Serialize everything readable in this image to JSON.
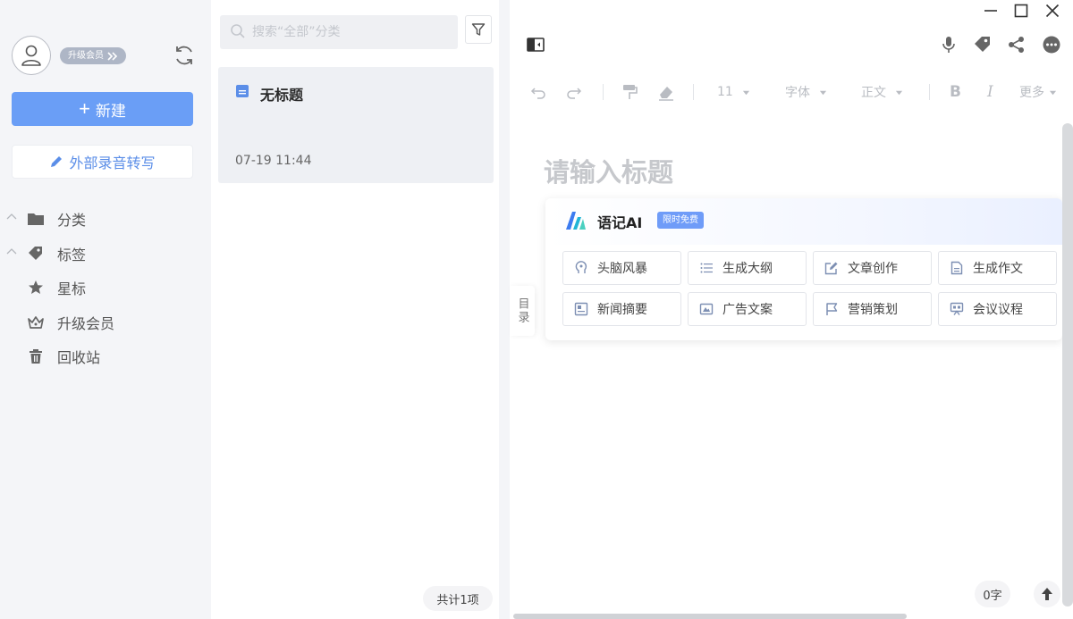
{
  "sidebar": {
    "vip_label": "升级会员",
    "new_label": "新建",
    "external_label": "外部录音转写",
    "items": [
      {
        "label": "分类",
        "icon": "folder-icon",
        "expandable": true
      },
      {
        "label": "标签",
        "icon": "tag-icon",
        "expandable": true
      },
      {
        "label": "星标",
        "icon": "star-icon",
        "expandable": false
      },
      {
        "label": "升级会员",
        "icon": "crown-icon",
        "expandable": false
      },
      {
        "label": "回收站",
        "icon": "trash-icon",
        "expandable": false
      }
    ]
  },
  "list": {
    "search_placeholder": "搜索“全部”分类",
    "notes": [
      {
        "title": "无标题",
        "time": "07-19 11:44"
      }
    ],
    "count_label": "共计1项"
  },
  "editor": {
    "toolbar": {
      "font_size": "11",
      "font_family": "字体",
      "paragraph_style": "正文",
      "bold": "B",
      "italic": "I",
      "more": "更多"
    },
    "title_placeholder": "请输入标题",
    "toc_label": "目录",
    "word_count": "0字",
    "ai": {
      "name": "语记AI",
      "badge": "限时免费",
      "actions": [
        {
          "label": "头脑风暴",
          "icon": "brain-icon"
        },
        {
          "label": "生成大纲",
          "icon": "list-icon"
        },
        {
          "label": "文章创作",
          "icon": "edit-icon"
        },
        {
          "label": "生成作文",
          "icon": "document-icon"
        },
        {
          "label": "新闻摘要",
          "icon": "news-icon"
        },
        {
          "label": "广告文案",
          "icon": "ad-icon"
        },
        {
          "label": "营销策划",
          "icon": "flag-icon"
        },
        {
          "label": "会议议程",
          "icon": "meeting-icon"
        }
      ]
    }
  },
  "colors": {
    "accent": "#6a9ef6",
    "sidebar_bg": "#f4f5f8",
    "selected_note_bg": "#eef0f4"
  }
}
